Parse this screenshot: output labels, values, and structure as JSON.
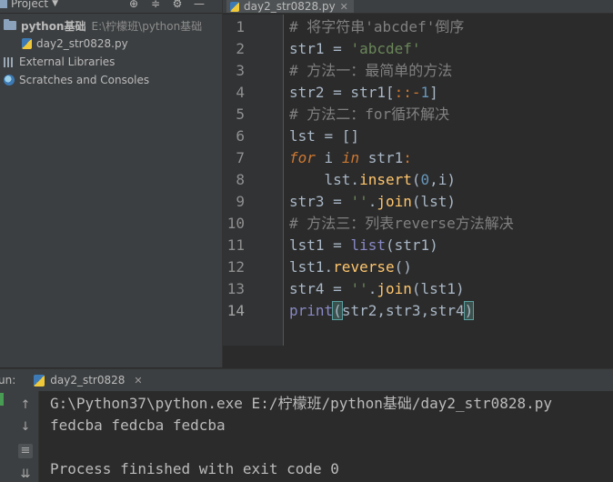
{
  "project_panel": {
    "title": "Project",
    "tool_icons": [
      "target-icon",
      "collapse-icon",
      "gear-icon",
      "hide-icon"
    ],
    "tree": [
      {
        "label": "python基础",
        "path": "E:\\柠檬班\\python基础",
        "icon": "folder-icon"
      },
      {
        "label": "day2_str0828.py",
        "icon": "python-file-icon"
      },
      {
        "label": "External Libraries",
        "icon": "libraries-icon"
      },
      {
        "label": "Scratches and Consoles",
        "icon": "scratches-icon"
      }
    ]
  },
  "editor": {
    "tab": {
      "label": "day2_str0828.py"
    },
    "current_line": 14,
    "line_numbers": [
      "1",
      "2",
      "3",
      "4",
      "5",
      "6",
      "7",
      "8",
      "9",
      "10",
      "11",
      "12",
      "13",
      "14"
    ],
    "code": {
      "l1": "# 将字符串'abcdef'倒序",
      "l2_var": "str1",
      "l2_eq": " = ",
      "l2_str": "'abcdef'",
      "l3": "# 方法一：最简单的方法",
      "l4_a": "str2 = str1[",
      "l4_b": "::-",
      "l4_c": "1",
      "l4_d": "]",
      "l5": "# 方法二：for循环解决",
      "l6": "lst = []",
      "l7_for": "for",
      "l7_i": " i ",
      "l7_in": "in",
      "l7_rest": " str1",
      "l7_colon": ":",
      "l8_a": "    lst.",
      "l8_fn": "insert",
      "l8_b": "(",
      "l8_num": "0",
      "l8_c": ",i)",
      "l9_a": "str3 = ",
      "l9_str": "''",
      "l9_b": ".",
      "l9_fn": "join",
      "l9_c": "(lst)",
      "l10": "# 方法三：列表reverse方法解决",
      "l11_a": "lst1 = ",
      "l11_bi": "list",
      "l11_b": "(str1)",
      "l12_a": "lst1.",
      "l12_fn": "reverse",
      "l12_b": "()",
      "l13_a": "str4 = ",
      "l13_str": "''",
      "l13_b": ".",
      "l13_fn": "join",
      "l13_c": "(lst1)",
      "l14_bi": "print",
      "l14_open": "(",
      "l14_mid": "str2,str3,str4",
      "l14_close": ")"
    }
  },
  "run_panel": {
    "label": "un:",
    "tab_label": "day2_str0828",
    "console": [
      "G:\\Python37\\python.exe E:/柠檬班/python基础/day2_str0828.py",
      "fedcba fedcba fedcba",
      "",
      "Process finished with exit code 0"
    ]
  },
  "colors": {
    "keyword": "#cc7832",
    "string": "#6a8759",
    "comment": "#808080",
    "number": "#6897bb",
    "builtin": "#8888c6",
    "method": "#ffc66d"
  }
}
